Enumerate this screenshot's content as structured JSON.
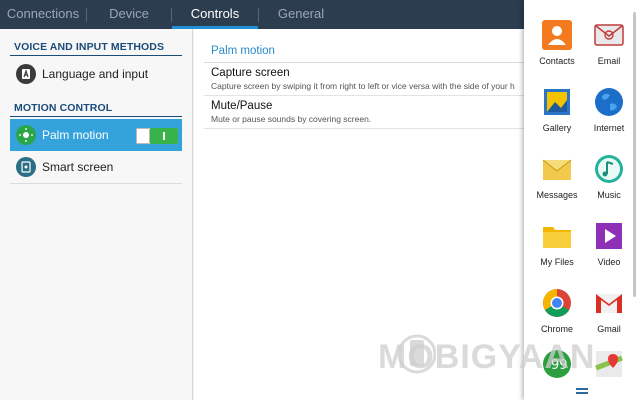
{
  "tabs": [
    {
      "label": "Connections"
    },
    {
      "label": "Device"
    },
    {
      "label": "Controls"
    },
    {
      "label": "General"
    }
  ],
  "active_tab": "Controls",
  "sidebar": {
    "sections": [
      {
        "header": "VOICE AND INPUT METHODS",
        "items": [
          {
            "label": "Language and input",
            "icon": "keyboard-icon"
          }
        ]
      },
      {
        "header": "MOTION CONTROL",
        "items": [
          {
            "label": "Palm motion",
            "icon": "palm-motion-icon",
            "toggle": "on"
          },
          {
            "label": "Smart screen",
            "icon": "smart-screen-icon"
          }
        ]
      }
    ]
  },
  "content": {
    "title": "Palm motion",
    "options": [
      {
        "title": "Capture screen",
        "desc": "Capture screen by swiping it from right to left or vice versa with the side of your h"
      },
      {
        "title": "Mute/Pause",
        "desc": "Mute or pause sounds by covering screen."
      }
    ]
  },
  "drawer": {
    "apps": [
      {
        "label": "Contacts",
        "icon": "contacts-icon"
      },
      {
        "label": "Email",
        "icon": "email-icon"
      },
      {
        "label": "Gallery",
        "icon": "gallery-icon"
      },
      {
        "label": "Internet",
        "icon": "internet-icon"
      },
      {
        "label": "Messages",
        "icon": "messages-icon"
      },
      {
        "label": "Music",
        "icon": "music-icon"
      },
      {
        "label": "My Files",
        "icon": "my-files-icon"
      },
      {
        "label": "Video",
        "icon": "video-icon"
      },
      {
        "label": "Chrome",
        "icon": "chrome-icon"
      },
      {
        "label": "Gmail",
        "icon": "gmail-icon"
      }
    ]
  },
  "watermark": "MOBIGYAAN",
  "colors": {
    "tabbar": "#2c3d50",
    "accent": "#1f8fd6",
    "selected": "#34a3db",
    "toggle_on": "#37b34a",
    "header_text": "#1a4c7a"
  }
}
